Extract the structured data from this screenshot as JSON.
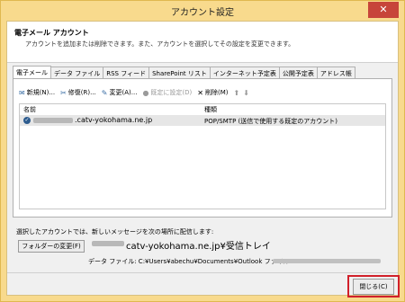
{
  "window": {
    "title": "アカウント設定",
    "close_glyph": "✕"
  },
  "header": {
    "title": "電子メール アカウント",
    "description": "アカウントを追加または削除できます。また、アカウントを選択してその設定を変更できます。"
  },
  "tabs": [
    {
      "label": "電子メール"
    },
    {
      "label": "データ ファイル"
    },
    {
      "label": "RSS フィード"
    },
    {
      "label": "SharePoint リスト"
    },
    {
      "label": "インターネット予定表"
    },
    {
      "label": "公開予定表"
    },
    {
      "label": "アドレス帳"
    }
  ],
  "toolbar": {
    "new_label": "新規(N)...",
    "repair_label": "修復(R)...",
    "change_label": "変更(A)...",
    "default_label": "既定に設定(D)",
    "delete_label": "削除(M)",
    "up_glyph": "⬆",
    "down_glyph": "⬇"
  },
  "list": {
    "col_name": "名前",
    "col_type": "種類",
    "rows": [
      {
        "account": ".catv-yokohama.ne.jp",
        "type": "POP/SMTP (送信で使用する既定のアカウント)"
      }
    ]
  },
  "delivery": {
    "label": "選択したアカウントでは、新しいメッセージを次の場所に配信します:",
    "change_folder_label": "フォルダーの変更(F)",
    "location": "catv-yokohama.ne.jp¥受信トレイ",
    "data_file": "データ ファイル: C:¥Users¥abechu¥Documents¥Outlook ファイル¥"
  },
  "footer": {
    "close_label": "閉じる(C)"
  }
}
